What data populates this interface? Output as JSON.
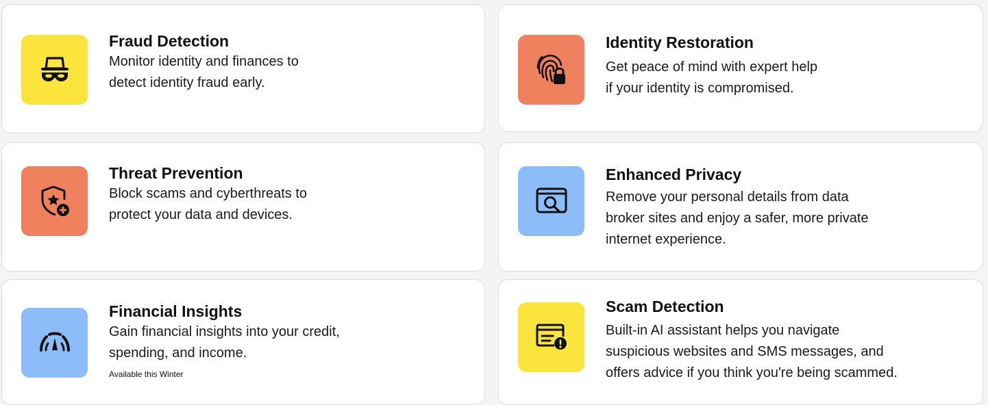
{
  "colors": {
    "yellow": "#fbe43b",
    "coral": "#f0815e",
    "blue": "#8dbdf8",
    "icon": "#111111"
  },
  "features": [
    {
      "title": "Fraud Detection",
      "lines": [
        "Monitor identity and finances to",
        "detect identity fraud early."
      ],
      "icon": "incognito-icon",
      "tile_color": "yellow"
    },
    {
      "title": "Identity Restoration",
      "lines": [
        "Get peace of mind with expert help",
        "if your identity is compromised."
      ],
      "icon": "fingerprint-lock-icon",
      "tile_color": "coral"
    },
    {
      "title": "Threat Prevention",
      "lines": [
        "Block scams and cyberthreats to",
        "protect your data and devices."
      ],
      "icon": "shield-star-icon",
      "tile_color": "coral"
    },
    {
      "title": "Enhanced Privacy",
      "lines": [
        "Remove your personal details from data",
        "broker sites and enjoy a safer, more private",
        "internet experience."
      ],
      "icon": "privacy-search-icon",
      "tile_color": "blue"
    },
    {
      "title": "Financial Insights",
      "lines": [
        "Gain financial insights into your credit,",
        "spending, and income."
      ],
      "note": "Available this Winter",
      "icon": "gauge-icon",
      "tile_color": "blue"
    },
    {
      "title": "Scam Detection",
      "lines": [
        "Built-in AI assistant helps you navigate",
        "suspicious websites and SMS messages, and",
        "offers advice if you think you're being scammed."
      ],
      "icon": "scam-alert-icon",
      "tile_color": "yellow"
    }
  ]
}
